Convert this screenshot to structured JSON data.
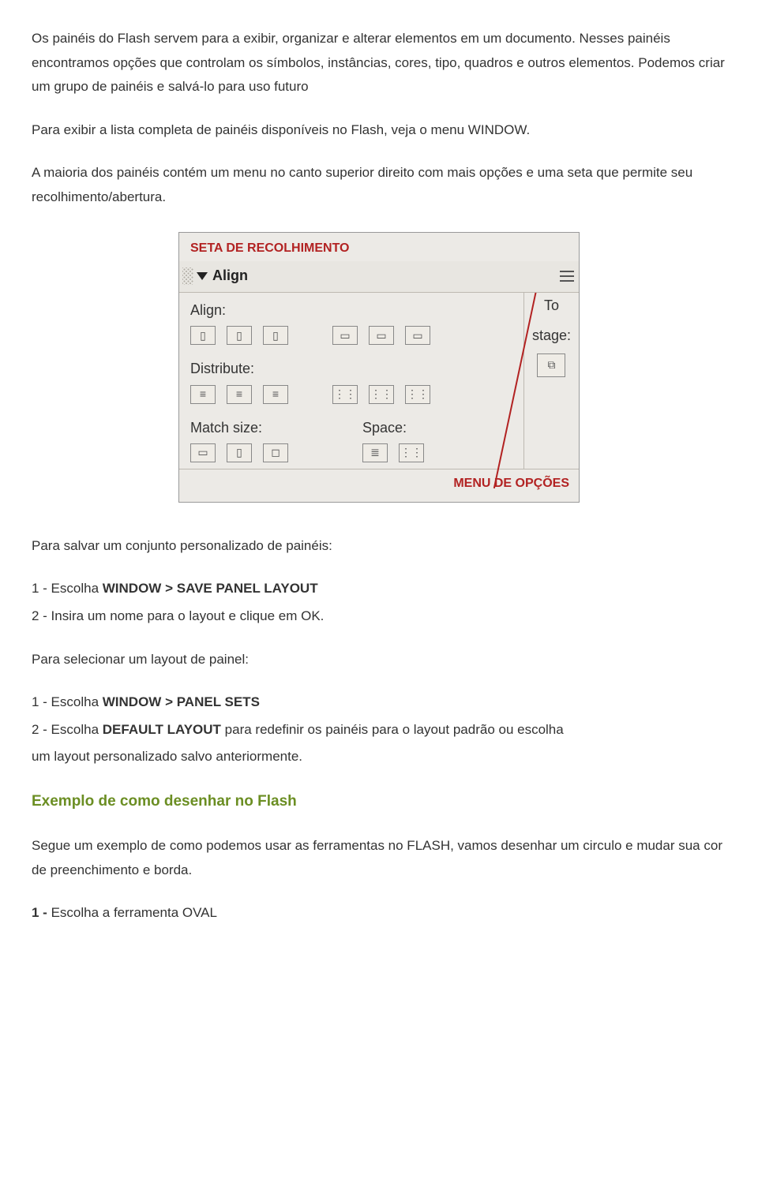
{
  "p1": "Os painéis do Flash servem para a exibir, organizar e alterar elementos em um documento. Nesses painéis encontramos opções que controlam os símbolos, instâncias, cores, tipo, quadros e outros elementos. Podemos criar um grupo de painéis e salvá-lo para uso futuro",
  "p2": "Para exibir a lista completa de painéis disponíveis no Flash, veja o menu WINDOW.",
  "p3": "A maioria dos painéis contém um menu no canto superior direito com mais opções e uma seta que permite seu recolhimento/abertura.",
  "panel": {
    "cap_top": "SETA DE RECOLHIMENTO",
    "title": "Align",
    "lbl_align": "Align:",
    "lbl_distribute": "Distribute:",
    "lbl_match": "Match size:",
    "lbl_space": "Space:",
    "to_stage_1": "To",
    "to_stage_2": "stage:",
    "cap_bot": "MENU DE OPÇÕES"
  },
  "p4": "Para salvar um conjunto personalizado de painéis:",
  "li1a": "1 - Escolha ",
  "li1b": "WINDOW > SAVE PANEL LAYOUT",
  "li2": "2 - Insira um nome para o layout e clique em OK.",
  "p5": "Para selecionar um layout de painel:",
  "li3a": "1 - Escolha ",
  "li3b": "WINDOW > PANEL SETS",
  "li4a": "2 - Escolha ",
  "li4b": "DEFAULT LAYOUT",
  "li4c": " para redefinir os painéis para o layout padrão ou escolha",
  "li5": "um layout personalizado salvo anteriormente.",
  "h1": "Exemplo de como desenhar no Flash",
  "p6": "Segue um exemplo de como podemos usar as ferramentas no FLASH, vamos desenhar um circulo e mudar sua cor de preenchimento e borda.",
  "li6a": "1 - ",
  "li6b": "Escolha a ferramenta OVAL"
}
